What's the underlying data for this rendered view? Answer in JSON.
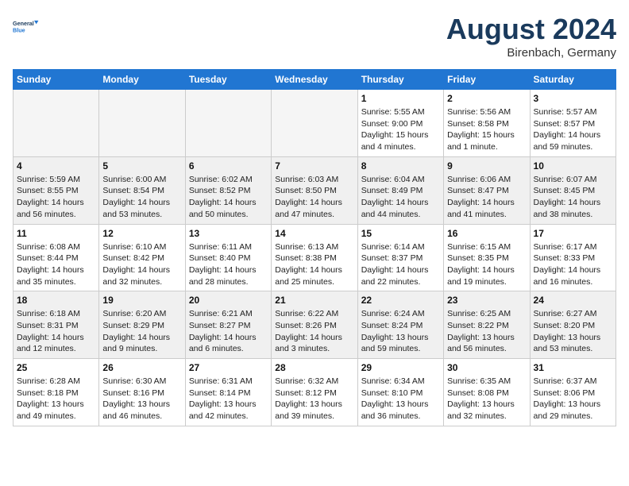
{
  "header": {
    "logo_line1": "General",
    "logo_line2": "Blue",
    "month": "August 2024",
    "location": "Birenbach, Germany"
  },
  "weekdays": [
    "Sunday",
    "Monday",
    "Tuesday",
    "Wednesday",
    "Thursday",
    "Friday",
    "Saturday"
  ],
  "weeks": [
    [
      {
        "day": "",
        "info": ""
      },
      {
        "day": "",
        "info": ""
      },
      {
        "day": "",
        "info": ""
      },
      {
        "day": "",
        "info": ""
      },
      {
        "day": "1",
        "info": "Sunrise: 5:55 AM\nSunset: 9:00 PM\nDaylight: 15 hours\nand 4 minutes."
      },
      {
        "day": "2",
        "info": "Sunrise: 5:56 AM\nSunset: 8:58 PM\nDaylight: 15 hours\nand 1 minute."
      },
      {
        "day": "3",
        "info": "Sunrise: 5:57 AM\nSunset: 8:57 PM\nDaylight: 14 hours\nand 59 minutes."
      }
    ],
    [
      {
        "day": "4",
        "info": "Sunrise: 5:59 AM\nSunset: 8:55 PM\nDaylight: 14 hours\nand 56 minutes."
      },
      {
        "day": "5",
        "info": "Sunrise: 6:00 AM\nSunset: 8:54 PM\nDaylight: 14 hours\nand 53 minutes."
      },
      {
        "day": "6",
        "info": "Sunrise: 6:02 AM\nSunset: 8:52 PM\nDaylight: 14 hours\nand 50 minutes."
      },
      {
        "day": "7",
        "info": "Sunrise: 6:03 AM\nSunset: 8:50 PM\nDaylight: 14 hours\nand 47 minutes."
      },
      {
        "day": "8",
        "info": "Sunrise: 6:04 AM\nSunset: 8:49 PM\nDaylight: 14 hours\nand 44 minutes."
      },
      {
        "day": "9",
        "info": "Sunrise: 6:06 AM\nSunset: 8:47 PM\nDaylight: 14 hours\nand 41 minutes."
      },
      {
        "day": "10",
        "info": "Sunrise: 6:07 AM\nSunset: 8:45 PM\nDaylight: 14 hours\nand 38 minutes."
      }
    ],
    [
      {
        "day": "11",
        "info": "Sunrise: 6:08 AM\nSunset: 8:44 PM\nDaylight: 14 hours\nand 35 minutes."
      },
      {
        "day": "12",
        "info": "Sunrise: 6:10 AM\nSunset: 8:42 PM\nDaylight: 14 hours\nand 32 minutes."
      },
      {
        "day": "13",
        "info": "Sunrise: 6:11 AM\nSunset: 8:40 PM\nDaylight: 14 hours\nand 28 minutes."
      },
      {
        "day": "14",
        "info": "Sunrise: 6:13 AM\nSunset: 8:38 PM\nDaylight: 14 hours\nand 25 minutes."
      },
      {
        "day": "15",
        "info": "Sunrise: 6:14 AM\nSunset: 8:37 PM\nDaylight: 14 hours\nand 22 minutes."
      },
      {
        "day": "16",
        "info": "Sunrise: 6:15 AM\nSunset: 8:35 PM\nDaylight: 14 hours\nand 19 minutes."
      },
      {
        "day": "17",
        "info": "Sunrise: 6:17 AM\nSunset: 8:33 PM\nDaylight: 14 hours\nand 16 minutes."
      }
    ],
    [
      {
        "day": "18",
        "info": "Sunrise: 6:18 AM\nSunset: 8:31 PM\nDaylight: 14 hours\nand 12 minutes."
      },
      {
        "day": "19",
        "info": "Sunrise: 6:20 AM\nSunset: 8:29 PM\nDaylight: 14 hours\nand 9 minutes."
      },
      {
        "day": "20",
        "info": "Sunrise: 6:21 AM\nSunset: 8:27 PM\nDaylight: 14 hours\nand 6 minutes."
      },
      {
        "day": "21",
        "info": "Sunrise: 6:22 AM\nSunset: 8:26 PM\nDaylight: 14 hours\nand 3 minutes."
      },
      {
        "day": "22",
        "info": "Sunrise: 6:24 AM\nSunset: 8:24 PM\nDaylight: 13 hours\nand 59 minutes."
      },
      {
        "day": "23",
        "info": "Sunrise: 6:25 AM\nSunset: 8:22 PM\nDaylight: 13 hours\nand 56 minutes."
      },
      {
        "day": "24",
        "info": "Sunrise: 6:27 AM\nSunset: 8:20 PM\nDaylight: 13 hours\nand 53 minutes."
      }
    ],
    [
      {
        "day": "25",
        "info": "Sunrise: 6:28 AM\nSunset: 8:18 PM\nDaylight: 13 hours\nand 49 minutes."
      },
      {
        "day": "26",
        "info": "Sunrise: 6:30 AM\nSunset: 8:16 PM\nDaylight: 13 hours\nand 46 minutes."
      },
      {
        "day": "27",
        "info": "Sunrise: 6:31 AM\nSunset: 8:14 PM\nDaylight: 13 hours\nand 42 minutes."
      },
      {
        "day": "28",
        "info": "Sunrise: 6:32 AM\nSunset: 8:12 PM\nDaylight: 13 hours\nand 39 minutes."
      },
      {
        "day": "29",
        "info": "Sunrise: 6:34 AM\nSunset: 8:10 PM\nDaylight: 13 hours\nand 36 minutes."
      },
      {
        "day": "30",
        "info": "Sunrise: 6:35 AM\nSunset: 8:08 PM\nDaylight: 13 hours\nand 32 minutes."
      },
      {
        "day": "31",
        "info": "Sunrise: 6:37 AM\nSunset: 8:06 PM\nDaylight: 13 hours\nand 29 minutes."
      }
    ]
  ]
}
